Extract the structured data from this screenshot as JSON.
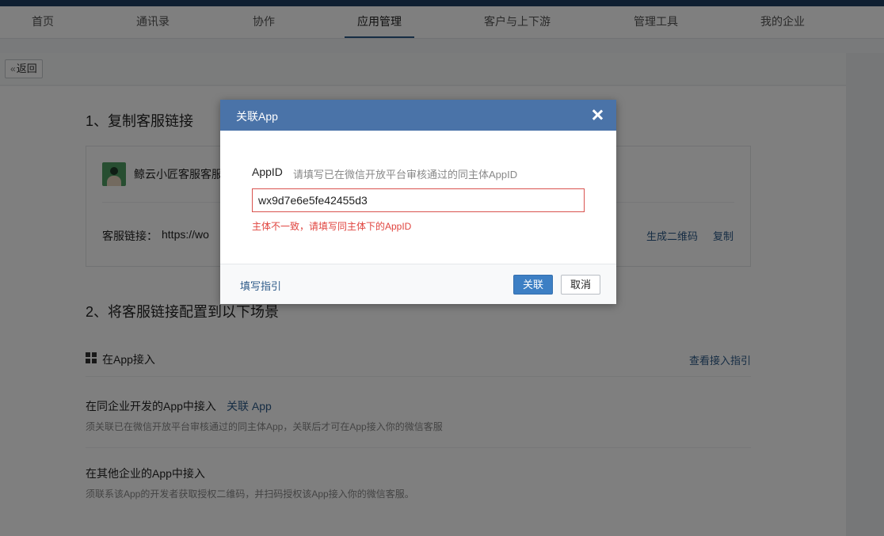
{
  "nav": {
    "items": [
      {
        "label": "首页"
      },
      {
        "label": "通讯录"
      },
      {
        "label": "协作"
      },
      {
        "label": "应用管理",
        "active": true
      },
      {
        "label": "客户与上下游"
      },
      {
        "label": "管理工具"
      },
      {
        "label": "我的企业"
      }
    ]
  },
  "page": {
    "back_label": "返回",
    "back_icon": "double-chevron-left-icon",
    "step1_title": "1、复制客服链接",
    "service_name": "鲸云小匠客服客服",
    "link_label": "客服链接：",
    "link_value": "https://wo",
    "qr_label": "生成二维码",
    "copy_label": "复制",
    "step2_title": "2、将客服链接配置到以下场景",
    "app_section_title": "在App接入",
    "app_section_icon": "grid-icon",
    "view_guide_label": "查看接入指引",
    "same_corp_title": "在同企业开发的App中接入",
    "same_corp_link": "关联 App",
    "same_corp_desc": "须关联已在微信开放平台审核通过的同主体App，关联后才可在App接入你的微信客服",
    "other_corp_title": "在其他企业的App中接入",
    "other_corp_desc": "须联系该App的开发者获取授权二维码，并扫码授权该App接入你的微信客服。"
  },
  "modal": {
    "title": "关联App",
    "close_icon": "close-icon",
    "field_label": "AppID",
    "field_hint": "请填写已在微信开放平台审核通过的同主体AppID",
    "field_value": "wx9d7e6e5fe42455d3",
    "error_text": "主体不一致，请填写同主体下的AppID",
    "guide_link": "填写指引",
    "confirm_label": "关联",
    "cancel_label": "取消"
  },
  "colors": {
    "header_bar": "#4a73a8",
    "primary_button": "#3d7fc4",
    "link": "#2d5a88",
    "error": "#e0443f",
    "top_strip": "#1f3e62"
  }
}
